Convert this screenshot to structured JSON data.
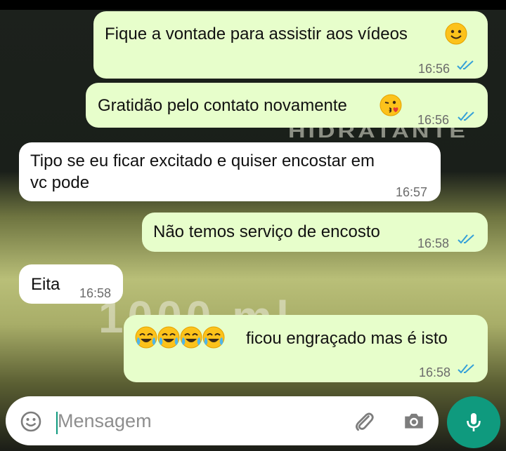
{
  "chat": {
    "messages": [
      {
        "direction": "out",
        "text": "Fique a vontade para assistir aos vídeos",
        "emoji": "slightly-smiling-face",
        "time": "16:56",
        "status": "read"
      },
      {
        "direction": "out",
        "text": "Gratidão pelo contato novamente",
        "emoji": "face-blowing-kiss",
        "time": "16:56",
        "status": "read"
      },
      {
        "direction": "in",
        "text_line1": "Tipo se eu ficar excitado e quiser encostar em",
        "text_line2": "vc pode",
        "time": "16:57"
      },
      {
        "direction": "out",
        "text": "Não temos serviço de encosto",
        "time": "16:58",
        "status": "read"
      },
      {
        "direction": "in",
        "text": "Eita",
        "time": "16:58"
      },
      {
        "direction": "out",
        "emoji": "face-with-tears-of-joy",
        "emoji_count": 4,
        "text": "ficou engraçado mas é isto",
        "time": "16:58",
        "status": "read"
      }
    ]
  },
  "composer": {
    "placeholder": "Mensagem",
    "icons": [
      "emoji-icon",
      "attach-icon",
      "camera-icon",
      "mic-icon"
    ]
  },
  "colors": {
    "outgoing_bubble": "#e7fecb",
    "incoming_bubble": "#ffffff",
    "read_ticks": "#34a0d8",
    "mic_button": "#0f9a7e"
  }
}
